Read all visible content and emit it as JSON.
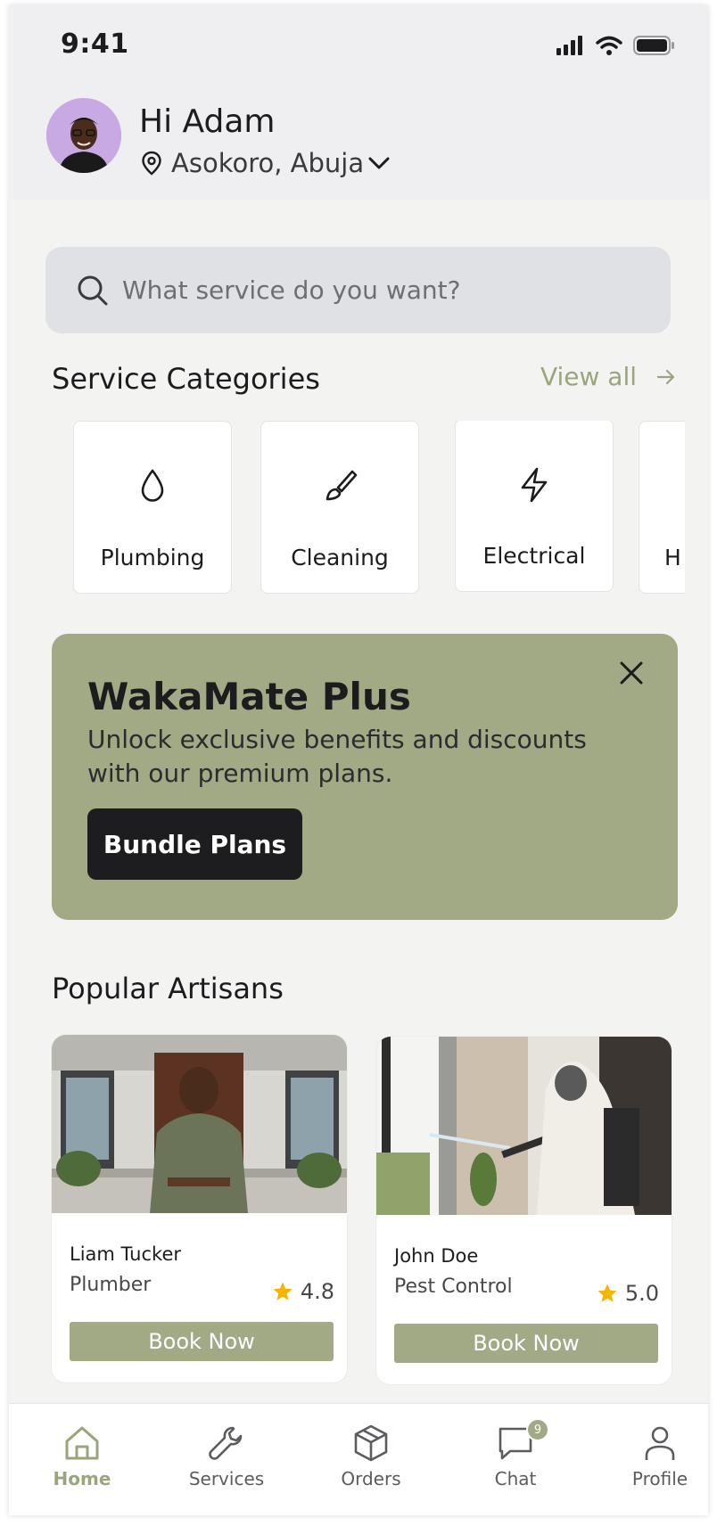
{
  "status_bar": {
    "time": "9:41"
  },
  "header": {
    "greeting": "Hi Adam",
    "location": "Asokoro, Abuja"
  },
  "search": {
    "placeholder": "What service do you want?"
  },
  "categories": {
    "title": "Service Categories",
    "view_all": "View all",
    "items": [
      {
        "label": "Plumbing",
        "icon": "water-drop-icon"
      },
      {
        "label": "Cleaning",
        "icon": "brush-icon"
      },
      {
        "label": "Electrical",
        "icon": "lightning-icon"
      },
      {
        "label": "H",
        "icon": "partial-category"
      }
    ]
  },
  "promo": {
    "title": "WakaMate Plus",
    "description": "Unlock exclusive benefits and discounts with our premium plans.",
    "button": "Bundle Plans"
  },
  "artisans": {
    "title": "Popular Artisans",
    "items": [
      {
        "name": "Liam Tucker",
        "role": "Plumber",
        "rating": "4.8",
        "button": "Book Now"
      },
      {
        "name": "John Doe",
        "role": "Pest Control",
        "rating": "5.0",
        "button": "Book Now"
      }
    ]
  },
  "tabbar": {
    "items": [
      {
        "label": "Home",
        "icon": "home-icon",
        "active": true
      },
      {
        "label": "Services",
        "icon": "wrench-icon"
      },
      {
        "label": "Orders",
        "icon": "box-icon"
      },
      {
        "label": "Chat",
        "icon": "chat-icon",
        "badge": "9"
      },
      {
        "label": "Profile",
        "icon": "person-icon"
      }
    ]
  },
  "colors": {
    "accent": "#a1a985",
    "accent_text": "#9aa57c",
    "dark": "#1d1d1f",
    "background": "#f3f3f1"
  }
}
